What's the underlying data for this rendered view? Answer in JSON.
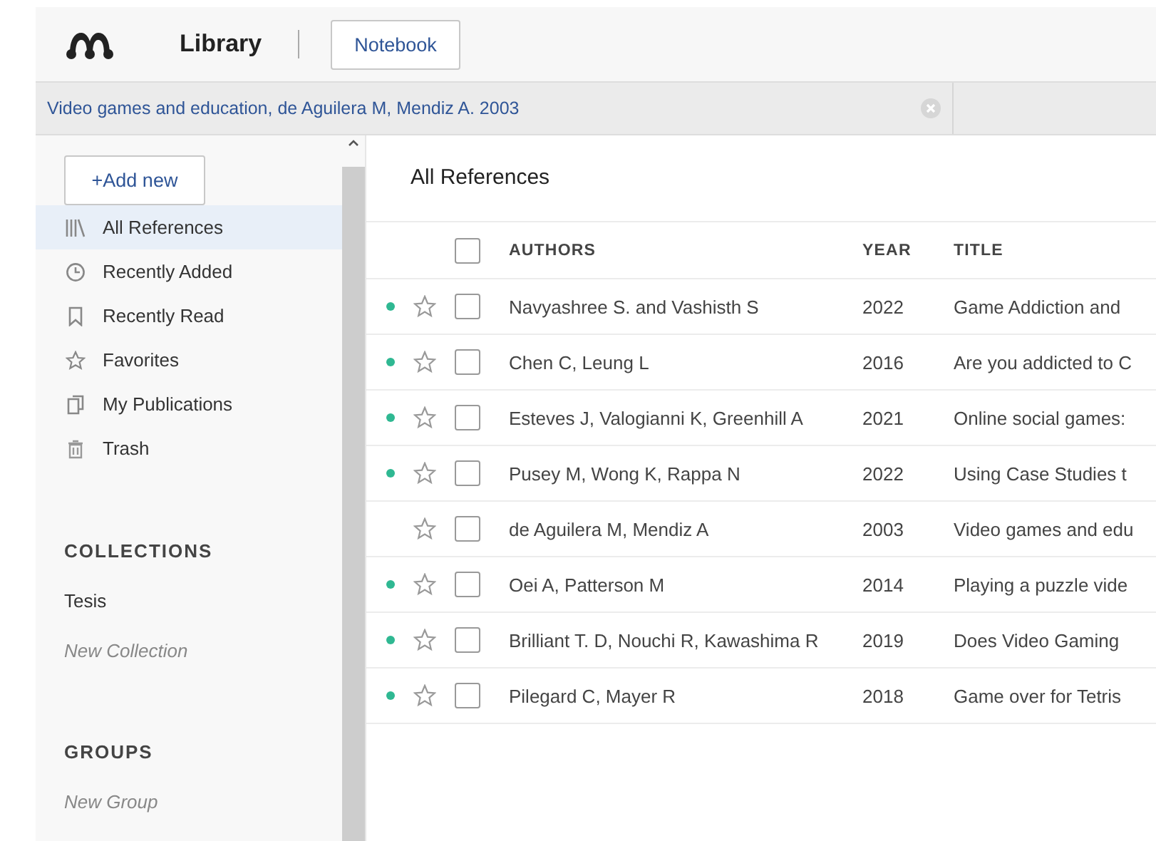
{
  "header": {
    "title": "Library",
    "notebook_button": "Notebook"
  },
  "doc_tabs": [
    {
      "label": "Video games and education, de Aguilera M, Mendiz A. 2003",
      "selected": true
    }
  ],
  "sidebar": {
    "add_button": "+Add new",
    "items": [
      {
        "label": "All References",
        "selected": true
      },
      {
        "label": "Recently Added",
        "selected": false
      },
      {
        "label": "Recently Read",
        "selected": false
      },
      {
        "label": "Favorites",
        "selected": false
      },
      {
        "label": "My Publications",
        "selected": false
      },
      {
        "label": "Trash",
        "selected": false
      }
    ],
    "collections": {
      "heading": "COLLECTIONS",
      "items": [
        "Tesis"
      ],
      "new_item": "New Collection"
    },
    "groups": {
      "heading": "GROUPS",
      "new_item": "New Group"
    }
  },
  "main": {
    "heading": "All References",
    "select_all_checked": false,
    "columns": [
      "AUTHORS",
      "YEAR",
      "TITLE"
    ],
    "rows": [
      {
        "unread": true,
        "favorite": false,
        "checked": false,
        "authors": "Navyashree S. and Vashisth S",
        "year": "2022",
        "title": "Game Addiction and"
      },
      {
        "unread": true,
        "favorite": false,
        "checked": false,
        "authors": "Chen C, Leung L",
        "year": "2016",
        "title": "Are you addicted to C"
      },
      {
        "unread": true,
        "favorite": false,
        "checked": false,
        "authors": "Esteves J, Valogianni K, Greenhill A",
        "year": "2021",
        "title": "Online social games:"
      },
      {
        "unread": true,
        "favorite": false,
        "checked": false,
        "authors": "Pusey M, Wong K, Rappa N",
        "year": "2022",
        "title": "Using Case Studies t"
      },
      {
        "unread": false,
        "favorite": false,
        "checked": false,
        "authors": "de Aguilera M, Mendiz A",
        "year": "2003",
        "title": "Video games and edu"
      },
      {
        "unread": true,
        "favorite": false,
        "checked": false,
        "authors": "Oei A, Patterson M",
        "year": "2014",
        "title": "Playing a puzzle vide"
      },
      {
        "unread": true,
        "favorite": false,
        "checked": false,
        "authors": "Brilliant T. D, Nouchi R, Kawashima R",
        "year": "2019",
        "title": "Does Video Gaming"
      },
      {
        "unread": true,
        "favorite": false,
        "checked": false,
        "authors": "Pilegard C, Mayer R",
        "year": "2018",
        "title": "Game over for Tetris"
      }
    ]
  }
}
